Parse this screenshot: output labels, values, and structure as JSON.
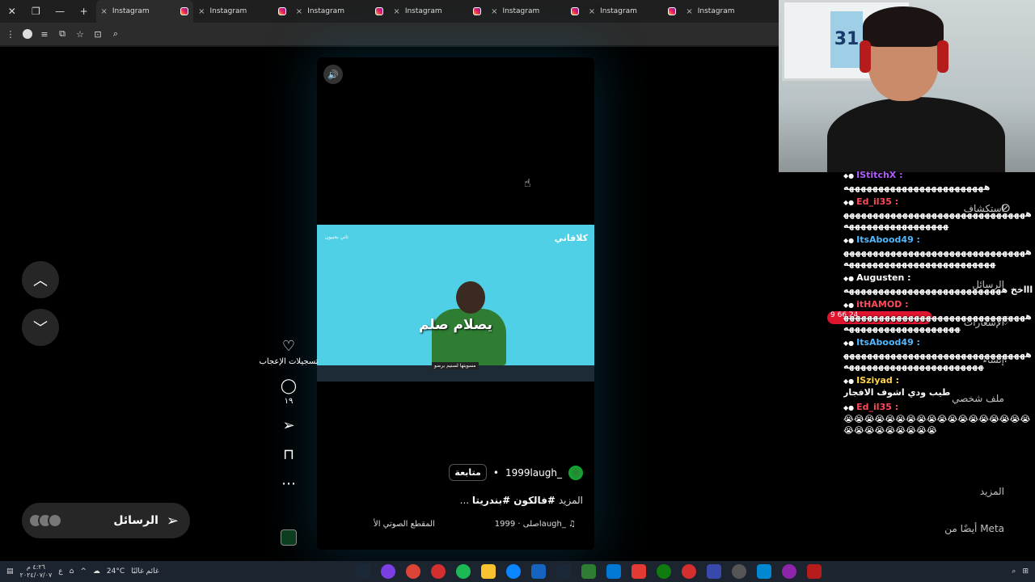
{
  "browser": {
    "tabs": [
      {
        "title": "Instagram",
        "active": true
      },
      {
        "title": "Instagram",
        "active": false
      },
      {
        "title": "Instagram",
        "active": false
      },
      {
        "title": "Instagram",
        "active": false
      },
      {
        "title": "Instagram",
        "active": false
      },
      {
        "title": "Instagram",
        "active": false
      },
      {
        "title": "Instagram",
        "active": false
      }
    ],
    "new_tab_symbol": "+",
    "close_symbol": "×"
  },
  "reel": {
    "video_caption": "يصلام صلم",
    "video_subtitle": "مسويتها لسنيم برضو",
    "brand": "كلافاني",
    "corner_text": "تاني بحبيون",
    "author": "1999laugh_",
    "follow_label": "متابعة",
    "caption_tags": "#فالكون #بندريتا",
    "caption_more": "... المزيد",
    "audio_left": "المقطع الصوتي الأ",
    "audio_right": "صلى · 1999laugh_"
  },
  "actions": {
    "likes_label": "تسجيلات الإعجاب",
    "comments_count": "١٩"
  },
  "messages": {
    "label": "الرسائل"
  },
  "chat": [
    {
      "user": "IStitchX",
      "color": "#b05cff",
      "text": "ههههههههههههههههههههههههه"
    },
    {
      "user": "Ed_il35",
      "color": "#ff4a5a",
      "text": "هههههههههههههههههههههههههههههههههههههههههههههههههه"
    },
    {
      "user": "ItsAbood49",
      "color": "#52b8ff",
      "text": "هههههههههههههههههههههههههههههههههههههههههههههههههههههههههه"
    },
    {
      "user": "Augusten",
      "color": "#ffffff",
      "text": "اااخخ هههههههههههههههههههههههههههه"
    },
    {
      "user": "itHAMOD",
      "color": "#ff4a5a",
      "text": "هههههههههههههههههههههههههههههههههههههههههههههههههههه"
    },
    {
      "user": "ItsAbood49",
      "color": "#52b8ff",
      "text": "هههههههههههههههههههههههههههههههههههههههههههههههههههههههه"
    },
    {
      "user": "ISziyad",
      "color": "#ffd54a",
      "text": "طيب ودي اشوف الافجار"
    },
    {
      "user": "Ed_il35",
      "color": "#ff4a5a",
      "text": "😭😭😭😭😭😭😭😭😭😭😭😭😭😭😭😭😭😭😭😭😭😭😭😭😭😭😭"
    }
  ],
  "sidebar_ghost": {
    "explore": "استكشاف",
    "messages": "الرسائل",
    "notifications": "الإشعارات",
    "create": "إنشاء",
    "profile": "ملف شخصي",
    "more": "المزيد",
    "meta": "أيضًا من Meta"
  },
  "live_pill_text": "9 66 24",
  "taskbar": {
    "time": "٤:٢٦ م",
    "date": "٢٠٢٤/٠٧/٠٧",
    "lang": "ع",
    "weather_temp": "24°C",
    "weather_text": "غائم غالبًا"
  },
  "colors": {
    "accent_teal": "#4fd0e6",
    "live_red": "#e0142f",
    "background": "#000000"
  }
}
